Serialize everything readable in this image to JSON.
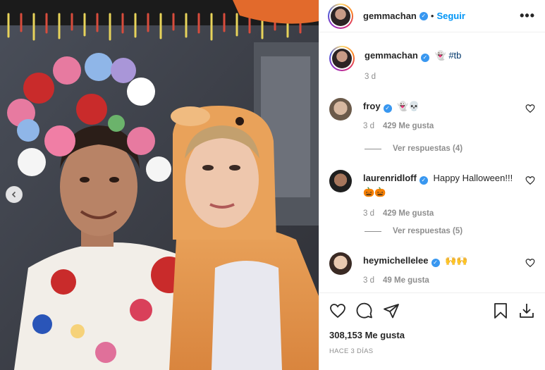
{
  "post": {
    "author": "gemmachan",
    "follow_label": "Seguir",
    "separator": "•",
    "more_label": "•••",
    "caption_emoji": "👻",
    "caption_hashtag": "#tb",
    "caption_time": "3 d"
  },
  "comments": [
    {
      "user": "froy",
      "text": "",
      "emoji": "👻💀",
      "time": "3 d",
      "likes": "429 Me gusta",
      "replies": "Ver respuestas (4)",
      "avatar_color": "#6b5a4a"
    },
    {
      "user": "laurenridloff",
      "text": "Happy Halloween!!!",
      "emoji": "🎃🎃",
      "time": "3 d",
      "likes": "429 Me gusta",
      "replies": "Ver respuestas (5)",
      "avatar_color": "#2a2a2a"
    },
    {
      "user": "heymichellelee",
      "text": "",
      "emoji": "🙌🙌",
      "time": "3 d",
      "likes": "49 Me gusta",
      "replies": "",
      "avatar_color": "#c8a58c"
    }
  ],
  "footer": {
    "likes": "308,153 Me gusta",
    "time_ago": "HACE 3 DÍAS"
  },
  "colors": {
    "link_blue": "#0095f6",
    "verified_blue": "#3897f0",
    "muted": "#8e8e8e"
  },
  "icons": [
    "chevron-left-icon",
    "heart-icon",
    "comment-icon",
    "share-icon",
    "bookmark-icon",
    "download-icon",
    "verified-icon",
    "more-icon"
  ]
}
